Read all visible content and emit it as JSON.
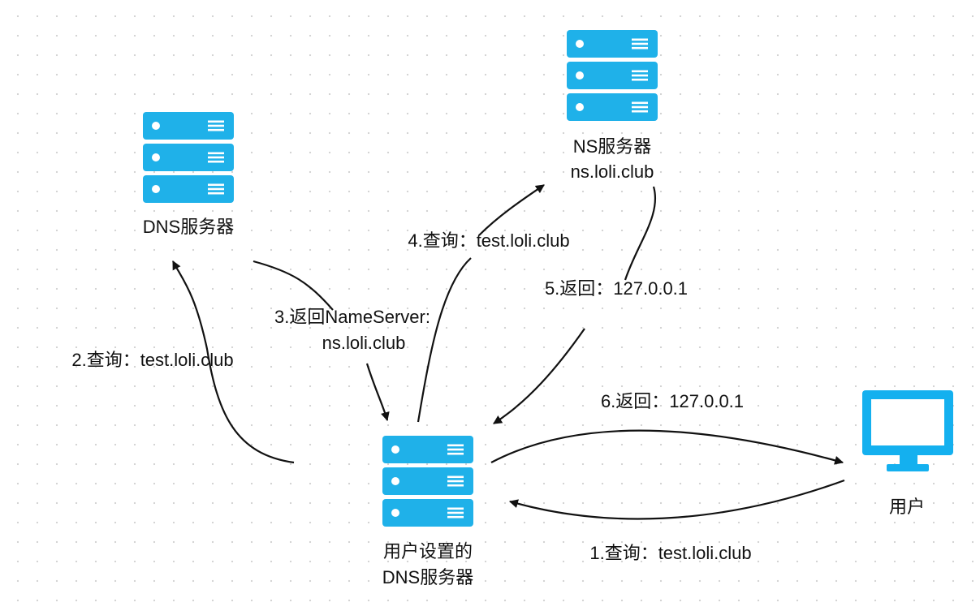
{
  "colors": {
    "server": "#1fb1e9",
    "slot": "#ffffff",
    "monitor": "#14b0ef",
    "line": "#111111",
    "grid_dot": "#d4d4d4"
  },
  "nodes": {
    "dns_server": {
      "icon": "server-icon",
      "label": "DNS服务器"
    },
    "ns_server": {
      "icon": "server-icon",
      "label_line1": "NS服务器",
      "label_line2": "ns.loli.club"
    },
    "user_dns": {
      "icon": "server-icon",
      "label_line1": "用户设置的",
      "label_line2": "DNS服务器"
    },
    "user": {
      "icon": "monitor-icon",
      "label": "用户"
    }
  },
  "edges": [
    {
      "id": "step1",
      "label": "1.查询：test.loli.club",
      "from": "user",
      "to": "user_dns"
    },
    {
      "id": "step2",
      "label": "2.查询：test.loli.club",
      "from": "user_dns",
      "to": "dns_server"
    },
    {
      "id": "step3",
      "label_line1": "3.返回NameServer:",
      "label_line2": "ns.loli.club",
      "from": "dns_server",
      "to": "user_dns"
    },
    {
      "id": "step4",
      "label": "4.查询：test.loli.club",
      "from": "user_dns",
      "to": "ns_server"
    },
    {
      "id": "step5",
      "label": "5.返回：127.0.0.1",
      "from": "ns_server",
      "to": "user_dns"
    },
    {
      "id": "step6",
      "label": "6.返回：127.0.0.1",
      "from": "user_dns",
      "to": "user"
    }
  ]
}
